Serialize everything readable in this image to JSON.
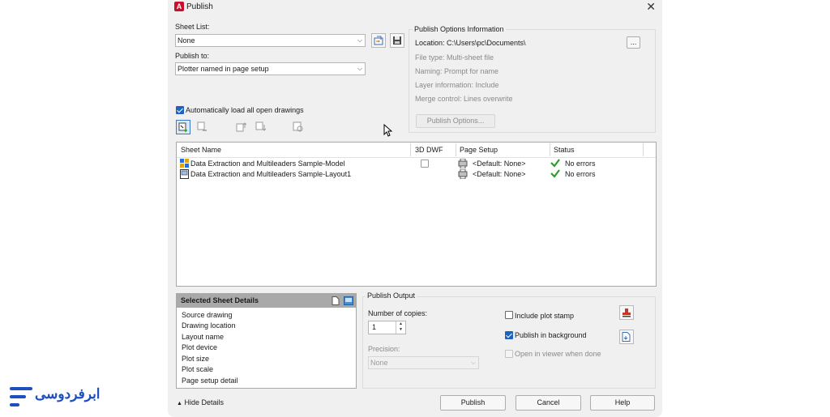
{
  "window": {
    "title": "Publish"
  },
  "sheet_list": {
    "label": "Sheet List:",
    "value": "None"
  },
  "publish_to": {
    "label": "Publish to:",
    "value": "Plotter named in page setup"
  },
  "auto_load": {
    "label": "Automatically load all open drawings",
    "checked": true
  },
  "options_info": {
    "title": "Publish Options Information",
    "location": "Location:  C:\\Users\\pc\\Documents\\",
    "browse_label": "...",
    "file_type": "File type: Multi-sheet file",
    "naming": "Naming: Prompt for name",
    "layer_info": "Layer information: Include",
    "merge_control": "Merge control: Lines overwrite",
    "publish_options_button": "Publish Options..."
  },
  "table": {
    "columns": [
      "Sheet Name",
      "3D DWF",
      "Page Setup",
      "Status"
    ],
    "rows": [
      {
        "name": "Data Extraction and Multileaders Sample-Model",
        "page_setup": "<Default: None>",
        "status": "No errors"
      },
      {
        "name": "Data Extraction and Multileaders Sample-Layout1",
        "page_setup": "<Default: None>",
        "status": "No errors"
      }
    ]
  },
  "details": {
    "title": "Selected Sheet Details",
    "rows": [
      "Source drawing",
      "Drawing location",
      "Layout name",
      "Plot device",
      "Plot size",
      "Plot scale",
      "Page setup detail"
    ]
  },
  "output": {
    "title": "Publish Output",
    "copies_label": "Number of copies:",
    "copies_value": "1",
    "precision_label": "Precision:",
    "precision_value": "None",
    "plot_stamp_label": "Include plot stamp",
    "background_label": "Publish in background",
    "viewer_label": "Open in viewer when done"
  },
  "footer": {
    "hide_details": "Hide Details",
    "publish_button": "Publish",
    "cancel_button": "Cancel",
    "help_button": "Help"
  },
  "brand": {
    "logo_text": "ابرفردوسی",
    "color": "#1d4fbe"
  }
}
